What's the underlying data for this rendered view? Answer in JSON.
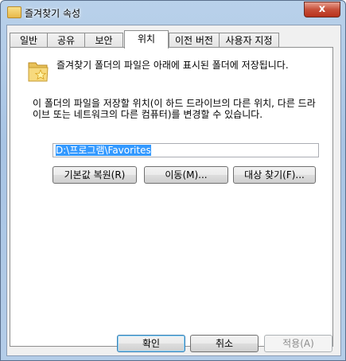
{
  "window": {
    "title": "즐겨찾기 속성",
    "close_label": "x"
  },
  "tabs": [
    {
      "label": "일반",
      "active": false
    },
    {
      "label": "공유",
      "active": false
    },
    {
      "label": "보안",
      "active": false
    },
    {
      "label": "위치",
      "active": true
    },
    {
      "label": "이전 버전",
      "active": false
    },
    {
      "label": "사용자 지정",
      "active": false
    }
  ],
  "location": {
    "description1": "즐겨찾기 폴더의 파일은 아래에 표시된 폴더에 저장됩니다.",
    "description2": "이 폴더의 파일을 저장할 위치(이 하드 드라이브의 다른 위치, 다른 드라이브 또는 네트워크의 다른 컴퓨터)를 변경할 수 있습니다.",
    "path_value": "D:\\프로그램\\Favorites",
    "restore_default_label": "기본값 복원(R)",
    "move_label": "이동(M)...",
    "find_target_label": "대상 찾기(F)..."
  },
  "footer": {
    "ok_label": "확인",
    "cancel_label": "취소",
    "apply_label": "적용(A)"
  },
  "colors": {
    "selection": "#3399ff",
    "close_button": "#c7503a"
  }
}
